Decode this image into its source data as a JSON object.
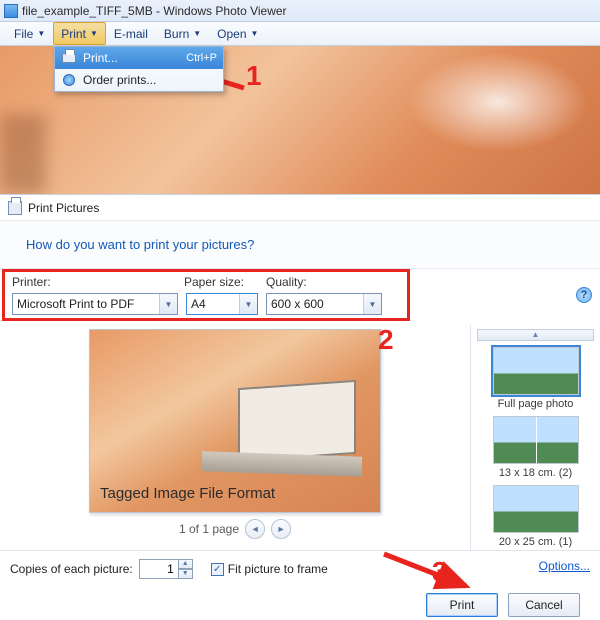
{
  "window": {
    "title": "file_example_TIFF_5MB - Windows Photo Viewer"
  },
  "menu": {
    "file": "File",
    "print": "Print",
    "email": "E-mail",
    "burn": "Burn",
    "open": "Open"
  },
  "dropdown": {
    "print": "Print...",
    "print_shortcut": "Ctrl+P",
    "order": "Order prints..."
  },
  "annotations": {
    "n1": "1",
    "n2": "2",
    "n3": "3"
  },
  "dlg": {
    "title": "Print Pictures",
    "banner": "How do you want to print your pictures?",
    "printer_label": "Printer:",
    "paper_label": "Paper size:",
    "quality_label": "Quality:",
    "printer_value": "Microsoft Print to PDF",
    "paper_value": "A4",
    "quality_value": "600 x 600",
    "help": "?",
    "preview_caption": "Tagged Image File Format",
    "pager": "1 of 1 page",
    "layouts": {
      "full": "Full page photo",
      "l13": "13 x 18 cm. (2)",
      "l20": "20 x 25 cm. (1)"
    },
    "copies_label": "Copies of each picture:",
    "copies_value": "1",
    "fit_label": "Fit picture to frame",
    "options": "Options...",
    "print_btn": "Print",
    "cancel_btn": "Cancel"
  }
}
